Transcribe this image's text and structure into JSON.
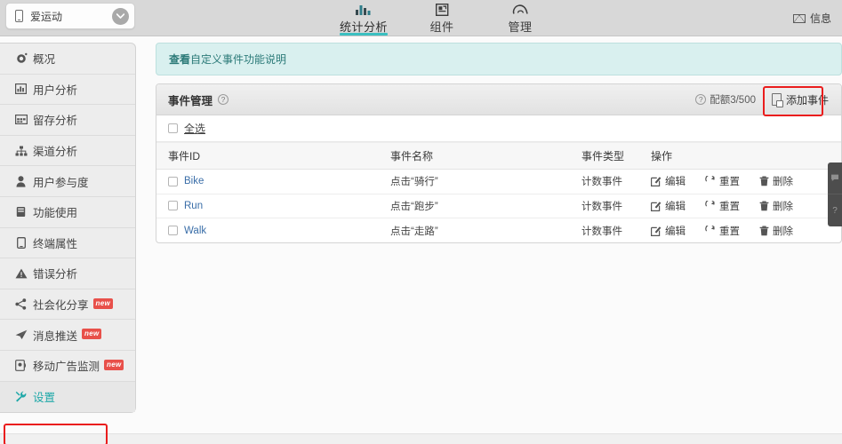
{
  "topbar": {
    "app_switcher": {
      "app_name": "爱运动",
      "icon": "phone-icon",
      "chevron": "chevron-down-icon"
    },
    "nav": [
      {
        "label": "统计分析",
        "icon": "bar-chart-icon",
        "active": true
      },
      {
        "label": "组件",
        "icon": "widget-icon",
        "active": false
      },
      {
        "label": "管理",
        "icon": "cloud-icon",
        "active": false
      }
    ],
    "message": {
      "label": "信息",
      "icon": "envelope-icon"
    },
    "accent_color": "#3bbfc0"
  },
  "sidebar": {
    "items": [
      {
        "label": "概况",
        "icon": "gear-icon",
        "new": false,
        "selected": false
      },
      {
        "label": "用户分析",
        "icon": "bar-chart-icon",
        "new": false,
        "selected": false
      },
      {
        "label": "留存分析",
        "icon": "grid-icon",
        "new": false,
        "selected": false
      },
      {
        "label": "渠道分析",
        "icon": "hierarchy-icon",
        "new": false,
        "selected": false
      },
      {
        "label": "用户参与度",
        "icon": "user-icon",
        "new": false,
        "selected": false
      },
      {
        "label": "功能使用",
        "icon": "server-icon",
        "new": false,
        "selected": false
      },
      {
        "label": "终端属性",
        "icon": "device-icon",
        "new": false,
        "selected": false
      },
      {
        "label": "错误分析",
        "icon": "warning-icon",
        "new": false,
        "selected": false
      },
      {
        "label": "社会化分享",
        "icon": "share-icon",
        "new": true,
        "selected": false
      },
      {
        "label": "消息推送",
        "icon": "paper-plane-icon",
        "new": true,
        "selected": false
      },
      {
        "label": "移动广告监测",
        "icon": "ad-monitor-icon",
        "new": true,
        "selected": false
      },
      {
        "label": "设置",
        "icon": "wrench-icon",
        "new": false,
        "selected": true
      }
    ],
    "badge_label": "new",
    "badge_color": "#e8504a",
    "selected_color": "#1fa8a8",
    "highlight_box_color": "#ea1d1d"
  },
  "content": {
    "notice": {
      "link_text": "查看",
      "text": "自定义事件功能说明"
    },
    "panel": {
      "title": "事件管理",
      "help_icon": "question-mark-icon",
      "quota_label": "配额3/500",
      "quota_icon": "question-mark-icon",
      "add_event": {
        "label": "添加事件",
        "icon": "new-page-icon"
      },
      "select_all_label": "全选",
      "columns": [
        "事件ID",
        "事件名称",
        "事件类型",
        "操作"
      ],
      "rows": [
        {
          "id": "Bike",
          "name": "点击“骑行”",
          "type": "计数事件",
          "ops": [
            {
              "label": "编辑",
              "icon": "pencil-square-icon"
            },
            {
              "label": "重置",
              "icon": "refresh-icon"
            },
            {
              "label": "删除",
              "icon": "trash-icon"
            }
          ]
        },
        {
          "id": "Run",
          "name": "点击“跑步”",
          "type": "计数事件",
          "ops": [
            {
              "label": "编辑",
              "icon": "pencil-square-icon"
            },
            {
              "label": "重置",
              "icon": "refresh-icon"
            },
            {
              "label": "删除",
              "icon": "trash-icon"
            }
          ]
        },
        {
          "id": "Walk",
          "name": "点击“走路”",
          "type": "计数事件",
          "ops": [
            {
              "label": "编辑",
              "icon": "pencil-square-icon"
            },
            {
              "label": "重置",
              "icon": "refresh-icon"
            },
            {
              "label": "删除",
              "icon": "trash-icon"
            }
          ]
        }
      ]
    }
  },
  "side_widget": {
    "buttons": [
      {
        "icon": "chat-bubble-icon",
        "label": ""
      },
      {
        "icon": "question-mark-icon",
        "label": "?"
      }
    ]
  }
}
